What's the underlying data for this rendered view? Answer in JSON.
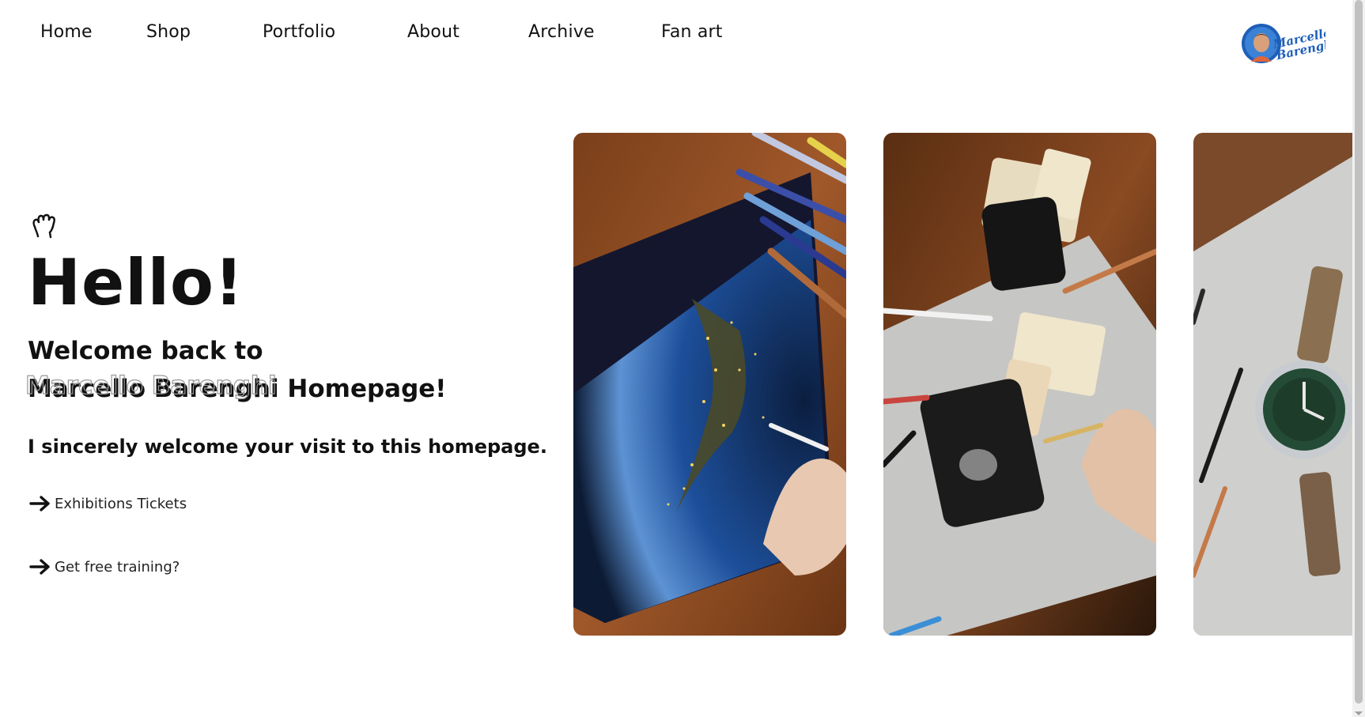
{
  "nav": {
    "items": [
      {
        "label": "Home"
      },
      {
        "label": "Shop"
      },
      {
        "label": "Portfolio"
      },
      {
        "label": "About"
      },
      {
        "label": "Archive"
      },
      {
        "label": "Fan art"
      }
    ]
  },
  "logo": {
    "text_line1": "Marcello",
    "text_line2": "Barenghi",
    "icon": "marcello-barenghi-logo"
  },
  "hero": {
    "wave_icon": "waving-hand-icon",
    "title": "Hello!",
    "welcome_line1": "Welcome back to",
    "welcome_name": "Marcello Barenghi",
    "welcome_suffix": " Homepage!",
    "subtitle": "I sincerely welcome your visit to this homepage.",
    "links": [
      {
        "label": "Exhibitions Tickets",
        "icon": "arrow-right-icon"
      },
      {
        "label": "Get free training?",
        "icon": "arrow-right-icon"
      }
    ]
  },
  "gallery": {
    "cards": [
      {
        "subject": "earth-at-night-drawing"
      },
      {
        "subject": "playing-cards-drawing"
      },
      {
        "subject": "wristwatch-drawing"
      }
    ]
  },
  "colors": {
    "text": "#111111",
    "background": "#ffffff",
    "logo_blue": "#1e5fb8"
  }
}
